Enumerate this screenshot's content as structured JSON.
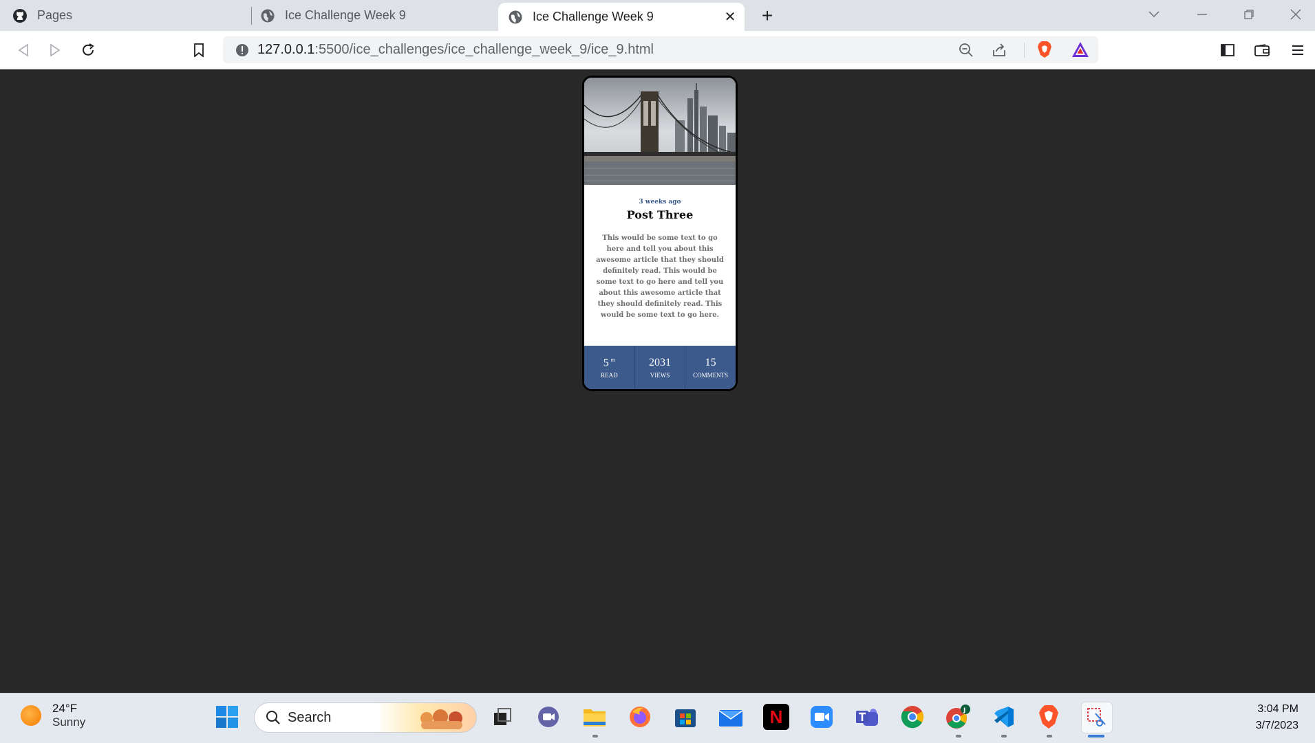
{
  "browser": {
    "tabs": [
      {
        "label": "Pages",
        "icon": "github-icon",
        "active": false
      },
      {
        "label": "Ice Challenge Week 9",
        "icon": "globe-icon",
        "active": false
      },
      {
        "label": "Ice Challenge Week 9",
        "icon": "globe-icon",
        "active": true
      }
    ],
    "url_host": "127.0.0.1",
    "url_path": ":5500/ice_challenges/ice_challenge_week_9/ice_9.html"
  },
  "card": {
    "image": "bridge-photo",
    "date": "3 weeks ago",
    "title": "Post Three",
    "description": "This would be some text to go here and tell you about this awesome article that they should definitely read. This would be some text to go here and tell you about this awesome article that they should definitely read. This would be some text to go here.",
    "stats": [
      {
        "value": "5",
        "sup": "m",
        "label": "READ"
      },
      {
        "value": "2031",
        "sup": "",
        "label": "VIEWS"
      },
      {
        "value": "15",
        "sup": "",
        "label": "COMMENTS"
      }
    ],
    "accent": "#3d5a8c"
  },
  "taskbar": {
    "weather_temp": "24°F",
    "weather_cond": "Sunny",
    "search_label": "Search",
    "time": "3:04 PM",
    "date": "3/7/2023"
  }
}
